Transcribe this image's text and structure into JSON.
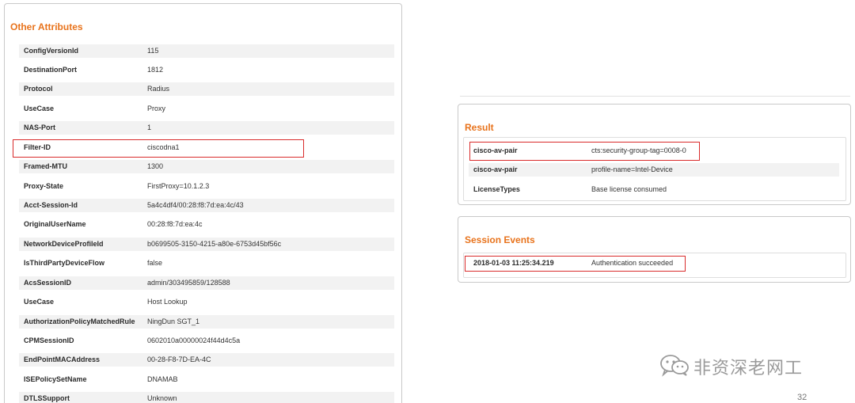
{
  "other_attributes": {
    "title": "Other Attributes",
    "rows": [
      {
        "key": "ConfigVersionId",
        "value": "115"
      },
      {
        "key": "DestinationPort",
        "value": "1812"
      },
      {
        "key": "Protocol",
        "value": "Radius"
      },
      {
        "key": "UseCase",
        "value": "Proxy"
      },
      {
        "key": "NAS-Port",
        "value": "1"
      },
      {
        "key": "Filter-ID",
        "value": "ciscodna1"
      },
      {
        "key": "Framed-MTU",
        "value": "1300"
      },
      {
        "key": "Proxy-State",
        "value": "FirstProxy=10.1.2.3"
      },
      {
        "key": "Acct-Session-Id",
        "value": "5a4c4df4/00:28:f8:7d:ea:4c/43"
      },
      {
        "key": "OriginalUserName",
        "value": "00:28:f8:7d:ea:4c"
      },
      {
        "key": "NetworkDeviceProfileId",
        "value": "b0699505-3150-4215-a80e-6753d45bf56c"
      },
      {
        "key": "IsThirdPartyDeviceFlow",
        "value": "false"
      },
      {
        "key": "AcsSessionID",
        "value": "admin/303495859/128588"
      },
      {
        "key": "UseCase",
        "value": "Host Lookup"
      },
      {
        "key": "AuthorizationPolicyMatchedRule",
        "value": "NingDun SGT_1"
      },
      {
        "key": "CPMSessionID",
        "value": "0602010a00000024f44d4c5a"
      },
      {
        "key": "EndPointMACAddress",
        "value": "00-28-F8-7D-EA-4C"
      },
      {
        "key": "ISEPolicySetName",
        "value": "DNAMAB"
      },
      {
        "key": "DTLSSupport",
        "value": "Unknown"
      }
    ]
  },
  "result": {
    "title": "Result",
    "rows": [
      {
        "key": "cisco-av-pair",
        "value": "cts:security-group-tag=0008-0"
      },
      {
        "key": "cisco-av-pair",
        "value": "profile-name=Intel-Device"
      },
      {
        "key": "LicenseTypes",
        "value": "Base license consumed"
      }
    ]
  },
  "session_events": {
    "title": "Session Events",
    "rows": [
      {
        "key": "2018-01-03 11:25:34.219",
        "value": "Authentication succeeded"
      }
    ]
  },
  "watermark": {
    "text": "非资深老网工",
    "icon": "wechat-icon"
  },
  "page_number": "32",
  "colors": {
    "accent": "#e8731c",
    "highlight": "#d92b2b",
    "row_shade": "#f2f2f2"
  }
}
